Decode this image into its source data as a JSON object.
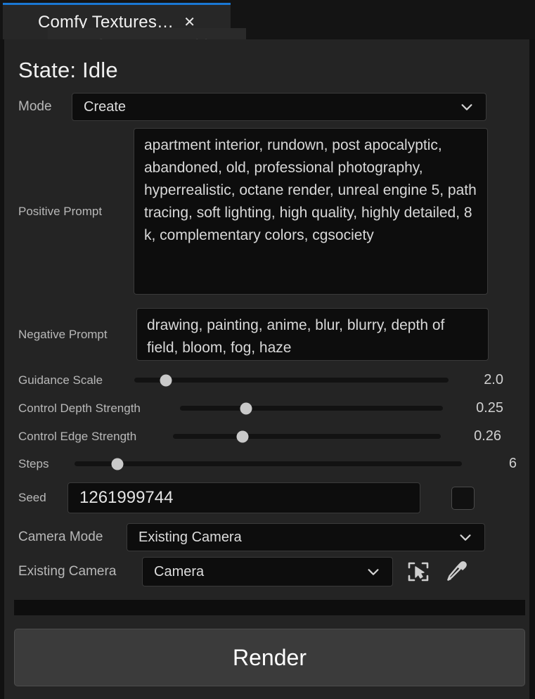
{
  "window": {
    "tab_title": "Comfy Textures…",
    "close_icon": "close-icon",
    "ghost_text": "Comfy Textures Widget",
    "accent_color": "#1a78d4"
  },
  "state": {
    "text": "State: Idle"
  },
  "fields": {
    "mode": {
      "label": "Mode",
      "value": "Create",
      "icon": "chevron-down-icon"
    },
    "positive_prompt": {
      "label": "Positive Prompt",
      "value": "apartment interior, rundown, post apocalyptic, abandoned, old, professional photography, hyperrealistic, octane render, unreal engine 5, path tracing, soft lighting, high quality, highly detailed, 8 k, complementary colors, cgsociety"
    },
    "negative_prompt": {
      "label": "Negative Prompt",
      "value": "drawing, painting, anime, blur, blurry, depth of field, bloom, fog, haze"
    },
    "seed": {
      "label": "Seed",
      "value": "1261999744",
      "checkbox_checked": false
    },
    "camera_mode": {
      "label": "Camera Mode",
      "value": "Existing Camera",
      "icon": "chevron-down-icon"
    },
    "existing_camera": {
      "label": "Existing Camera",
      "value": "Camera",
      "icon": "chevron-down-icon",
      "pick_actor_icon": "select-actor-icon",
      "eyedropper_icon": "eyedropper-icon"
    }
  },
  "sliders": [
    {
      "name": "guidance-scale",
      "label": "Guidance Scale",
      "value": "2.0",
      "fill_percent": 10
    },
    {
      "name": "control-depth-strength",
      "label": "Control Depth Strength",
      "value": "0.25",
      "fill_percent": 25
    },
    {
      "name": "control-edge-strength",
      "label": "Control Edge Strength",
      "value": "0.26",
      "fill_percent": 26
    },
    {
      "name": "steps",
      "label": "Steps",
      "value": "6",
      "fill_percent": 11
    }
  ],
  "bottom": {
    "progress_percent": 0,
    "render_label": "Render"
  }
}
